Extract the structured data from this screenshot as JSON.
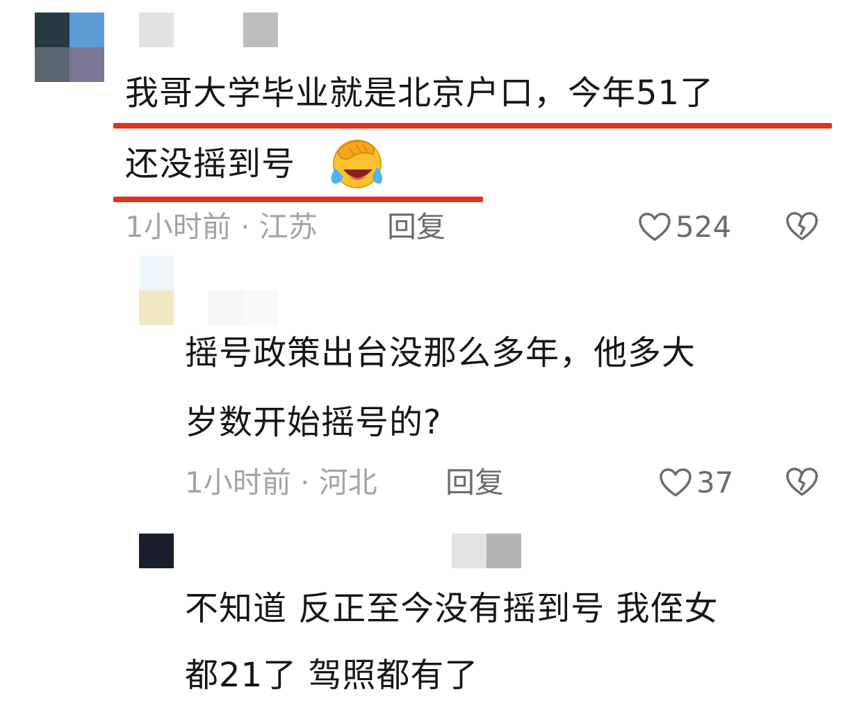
{
  "comments": [
    {
      "text_line1": "我哥大学毕业就是北京户口，今年51了",
      "text_line2": "还没摇到号",
      "emoji": "facepalm-laugh-emoji",
      "meta": "1小时前 · 江苏",
      "reply_label": "回复",
      "likes": "524"
    },
    {
      "text_line1": "摇号政策出台没那么多年，他多大",
      "text_line2": "岁数开始摇号的?",
      "meta": "1小时前 · 河北",
      "reply_label": "回复",
      "likes": "37"
    },
    {
      "text_line1": "不知道 反正至今没有摇到号 我侄女",
      "text_line2": "都21了 驾照都有了"
    }
  ],
  "colors": {
    "highlight_underline": "#e0331c",
    "meta_text": "#a3a3a3"
  }
}
